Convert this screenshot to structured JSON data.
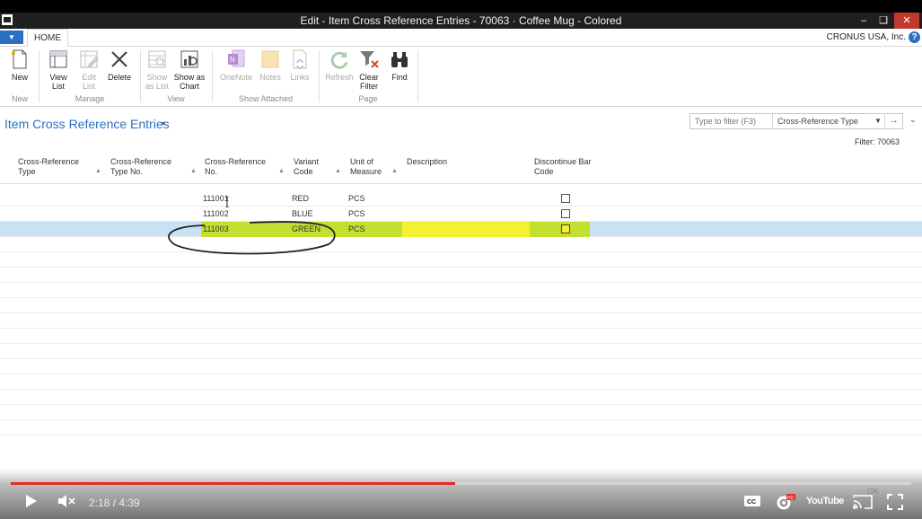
{
  "window": {
    "title": "Edit - Item Cross Reference Entries - 70063 · Coffee Mug - Colored",
    "minimize": "–",
    "maximize": "❏",
    "close": "✕"
  },
  "tabs": {
    "menu_glyph": "▼",
    "home": "HOME"
  },
  "company": "CRONUS USA, Inc.",
  "help_glyph": "?",
  "ribbon": {
    "new": "New",
    "view_list": "View\nList",
    "edit_list": "Edit\nList",
    "delete": "Delete",
    "show_as_list": "Show\nas List",
    "show_as_chart": "Show as\nChart",
    "onenote": "OneNote",
    "notes": "Notes",
    "links": "Links",
    "refresh": "Refresh",
    "clear_filter": "Clear\nFilter",
    "find": "Find",
    "groups": {
      "new": "New",
      "manage": "Manage",
      "view": "View",
      "show_attached": "Show Attached",
      "page": "Page"
    }
  },
  "page": {
    "title": "Item Cross Reference Entries",
    "caret": "▾",
    "filter_placeholder": "Type to filter (F3)",
    "filter_field": "Cross-Reference Type",
    "filter_go": "→",
    "expand": "⌄",
    "filter_text": "Filter: 70063"
  },
  "columns": [
    "Cross-Reference\nType",
    "Cross-Reference\nType No.",
    "Cross-Reference\nNo.",
    "Variant\nCode",
    "Unit of\nMeasure",
    "Description",
    "Discontinue Bar\nCode"
  ],
  "rows": [
    {
      "type": "",
      "type_no": "",
      "no": "111001",
      "variant": "RED",
      "uom": "PCS",
      "description": "",
      "discontinue": false,
      "selected": false
    },
    {
      "type": "",
      "type_no": "",
      "no": "111002",
      "variant": "BLUE",
      "uom": "PCS",
      "description": "",
      "discontinue": false,
      "selected": false
    },
    {
      "type": "",
      "type_no": "",
      "no": "111003",
      "variant": "GREEN",
      "uom": "PCS",
      "description": "",
      "discontinue": false,
      "selected": true
    }
  ],
  "colors": {
    "accent": "#2a6fc4",
    "selected_row": "#c8e2f4",
    "highlight_green": "#c3df2f",
    "highlight_yellow": "#f4f230"
  },
  "player": {
    "time": "2:18 / 4:39",
    "progress": 0.494,
    "ok": "OK",
    "youtube": "YouTube"
  }
}
